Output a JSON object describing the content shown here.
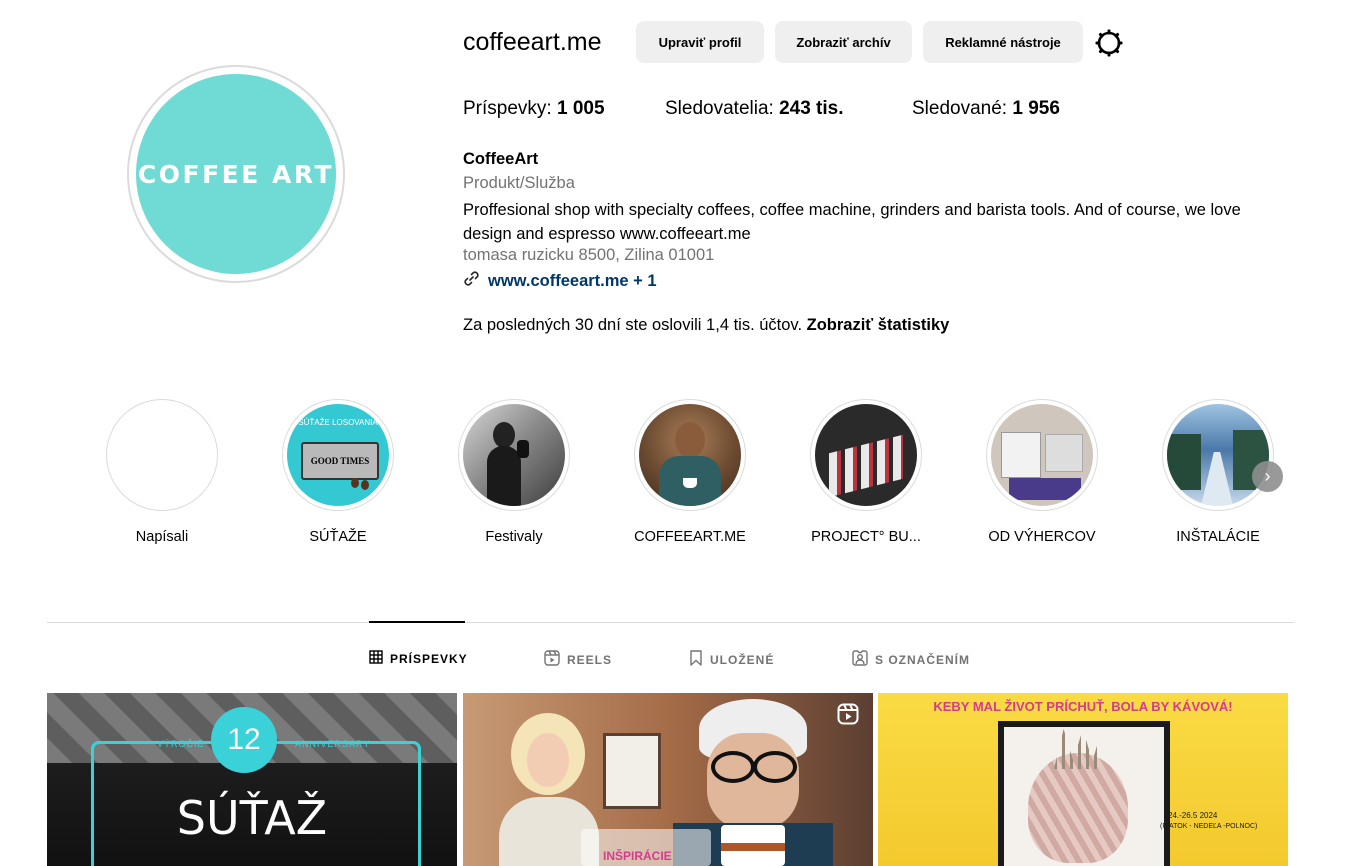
{
  "profile": {
    "username": "coffeeart.me",
    "avatar_logo": "COFFEE ART",
    "avatar_color": "#6fdbd4",
    "buttons": {
      "edit": "Upraviť profil",
      "archive": "Zobraziť archív",
      "ads": "Reklamné nástroje"
    },
    "settings_icon": "gear-icon",
    "stats": {
      "posts_label": "Príspevky:",
      "posts_value": "1 005",
      "followers_label": "Sledovatelia:",
      "followers_value": "243 tis.",
      "following_label": "Sledované:",
      "following_value": "1 956"
    },
    "display_name": "CoffeeArt",
    "category": "Produkt/Služba",
    "bio": "Proffesional shop with specialty coffees, coffee machine, grinders and barista tools. And of course, we love design and espresso www.coffeeart.me",
    "address": "tomasa ruzicku 8500, Zilina 01001",
    "link": "www.coffeeart.me + 1",
    "reach_text": "Za posledných 30 dní ste oslovili 1,4 tis. účtov.",
    "reach_link": "Zobraziť štatistiky"
  },
  "highlights": [
    {
      "label": "Napísali"
    },
    {
      "label": "SÚŤAŽE",
      "inner_text": "SÚŤAŽE LOSOVANIA",
      "ticket_text": "GOOD TIMES"
    },
    {
      "label": "Festivaly"
    },
    {
      "label": "COFFEEART.ME"
    },
    {
      "label": "PROJECT° BU..."
    },
    {
      "label": "OD VÝHERCOV"
    },
    {
      "label": "INŠTALÁCIE"
    }
  ],
  "tabs": [
    {
      "label": "PRÍSPEVKY",
      "icon": "grid-icon",
      "active": true
    },
    {
      "label": "REELS",
      "icon": "reels-icon",
      "active": false
    },
    {
      "label": "ULOŽENÉ",
      "icon": "bookmark-icon",
      "active": false
    },
    {
      "label": "S OZNAČENÍM",
      "icon": "tagged-icon",
      "active": false
    }
  ],
  "posts": [
    {
      "overlay_title": "SÚŤAŽ",
      "badge_number": "12",
      "left_label": "VÝROČIE",
      "right_label": "ANNIVERSARY"
    },
    {
      "overlay_caption": "INŠPIRÁCIE",
      "icon": "reels-icon"
    },
    {
      "headline": "KEBY MAL ŽIVOT PRÍCHUŤ, BOLA BY KÁVOVÁ!",
      "date_text": "24.-26.5 2024",
      "day_text": "(PIATOK - NEDEĽA -POLNOC)"
    }
  ]
}
